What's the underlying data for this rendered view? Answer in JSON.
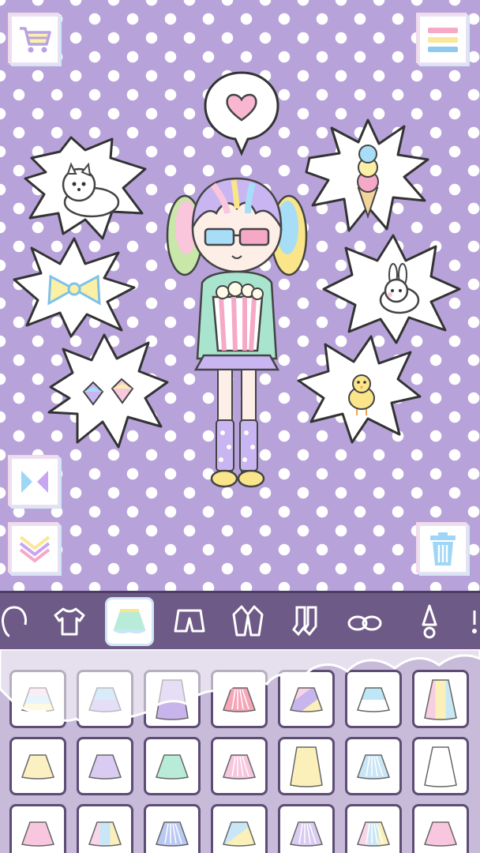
{
  "colors": {
    "background": "#b7a3da",
    "polka_dot": "#ffffff",
    "tab_bar": "#6d5a86",
    "drawer": "#c7bbd9",
    "outline": "#5d4d75"
  },
  "toolbar": {
    "shop_icon": "shopping-cart-icon",
    "menu_icon": "menu-icon",
    "flip_icon": "flip-icon",
    "collapse_icon": "collapse-icon",
    "delete_icon": "trash-icon"
  },
  "character": {
    "emote": "heart",
    "accessories": [
      "3d-glasses",
      "popcorn",
      "twin-tails"
    ]
  },
  "stickers": [
    {
      "icon": "dog-icon"
    },
    {
      "icon": "bow-icon"
    },
    {
      "icon": "gems-icon"
    },
    {
      "icon": "ice-cream-icon"
    },
    {
      "icon": "bunny-icon"
    },
    {
      "icon": "chick-icon"
    }
  ],
  "categories": [
    {
      "icon": "hair-icon",
      "active": false
    },
    {
      "icon": "tshirt-icon",
      "active": false
    },
    {
      "icon": "skirt-icon",
      "active": true
    },
    {
      "icon": "shorts-icon",
      "active": false
    },
    {
      "icon": "jacket-icon",
      "active": false
    },
    {
      "icon": "socks-icon",
      "active": false
    },
    {
      "icon": "shoes-icon",
      "active": false
    },
    {
      "icon": "accessory-icon",
      "active": false
    }
  ],
  "items": [
    {
      "colors": [
        "#f8d6ea",
        "#c9e6f6",
        "#fbf3bd"
      ],
      "style": "tiered"
    },
    {
      "colors": [
        "#a9d3f2",
        "#c7b5ee"
      ],
      "style": "tutu"
    },
    {
      "colors": [
        "#c8b4ea"
      ],
      "style": "long"
    },
    {
      "colors": [
        "#f6a6b8"
      ],
      "style": "pleated"
    },
    {
      "colors": [
        "#f6d3e6",
        "#c7b5ee",
        "#fbf0b9"
      ],
      "style": "diagonal"
    },
    {
      "colors": [
        "#bfe6f6",
        "#ffffff"
      ],
      "style": "ruffle"
    },
    {
      "colors": [
        "#f7cfe2",
        "#fbf0b9",
        "#c9e8f6"
      ],
      "style": "long-stripe"
    },
    {
      "colors": [
        "#fbf0c2"
      ],
      "style": "flare"
    },
    {
      "colors": [
        "#d9cbf1"
      ],
      "style": "a-line"
    },
    {
      "colors": [
        "#b9ecd8"
      ],
      "style": "buttoned"
    },
    {
      "colors": [
        "#f8c6de"
      ],
      "style": "pleated"
    },
    {
      "colors": [
        "#fbf0b9"
      ],
      "style": "long"
    },
    {
      "colors": [
        "#c9e6f6"
      ],
      "style": "pleated"
    },
    {
      "colors": [
        "#ffffff"
      ],
      "style": "long-flare"
    },
    {
      "colors": [
        "#f8c6de"
      ],
      "style": "flare"
    },
    {
      "colors": [
        "#f8d6ea",
        "#c9e6f6",
        "#fbf0b9"
      ],
      "style": "stripe"
    },
    {
      "colors": [
        "#b9c9f3"
      ],
      "style": "pleated"
    },
    {
      "colors": [
        "#c9e6f6",
        "#fbf0b9"
      ],
      "style": "diagonal"
    },
    {
      "colors": [
        "#d9cbf1"
      ],
      "style": "pleated"
    },
    {
      "colors": [
        "#f8d6ea",
        "#c9e6f6",
        "#fbf0b9"
      ],
      "style": "rainbow-pleated"
    },
    {
      "colors": [
        "#f8c6de"
      ],
      "style": "tiered"
    }
  ]
}
